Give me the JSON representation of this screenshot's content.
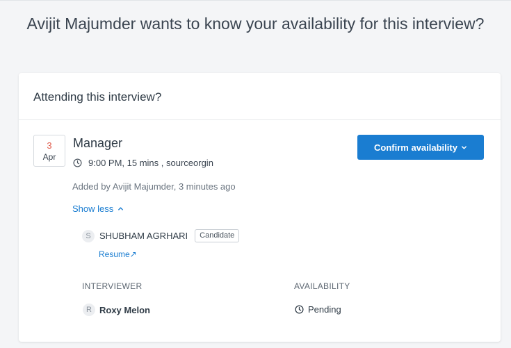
{
  "page": {
    "heading": "Avijit Majumder wants to know your availability for this interview?"
  },
  "card": {
    "header": "Attending this interview?",
    "date": {
      "day": "3",
      "month": "Apr"
    },
    "title": "Manager",
    "meta": "9:00 PM, 15 mins , sourceorgin",
    "added_by": "Added by Avijit Majumder, 3 minutes ago",
    "show_less": "Show less",
    "confirm_button": "Confirm availability",
    "candidate": {
      "initial": "S",
      "name": "SHUBHAM AGRHARI",
      "badge": "Candidate",
      "resume_label": "Resume↗"
    },
    "columns": {
      "interviewer": "INTERVIEWER",
      "availability": "AVAILABILITY"
    },
    "interviewers": [
      {
        "initial": "R",
        "name": "Roxy Melon",
        "status": "Pending"
      }
    ]
  },
  "colors": {
    "accent": "#1a7dd1",
    "date_day": "#e05a4a",
    "background": "#f4f5f7"
  },
  "icons": [
    "clock-icon",
    "chevron-up-icon",
    "chevron-down-icon",
    "external-link-icon"
  ]
}
